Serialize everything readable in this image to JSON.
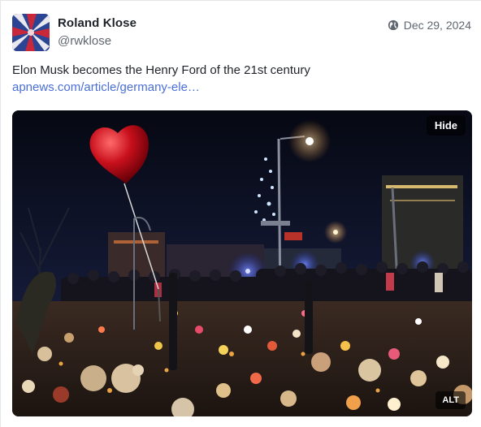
{
  "author": {
    "display_name": "Roland Klose",
    "handle": "@rwklose"
  },
  "meta": {
    "visibility_icon": "globe-icon",
    "date": "Dec 29, 2024"
  },
  "status": {
    "text": "Elon Musk becomes the Henry Ford of the 21st century",
    "link_text": "apnews.com/article/germany-ele…"
  },
  "media": {
    "hide_label": "Hide",
    "alt_label": "ALT"
  },
  "colors": {
    "link": "#4a6fd7",
    "name": "#1f2329",
    "muted": "#5f6670"
  }
}
